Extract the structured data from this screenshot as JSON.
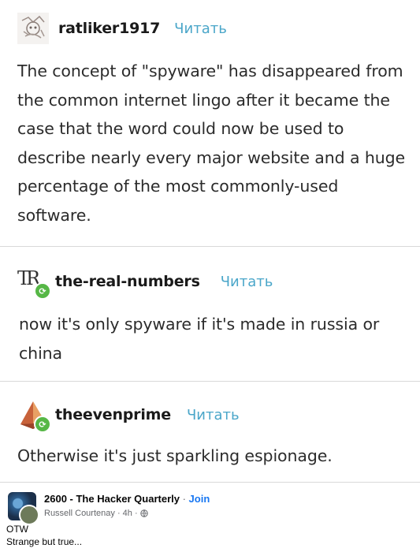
{
  "posts": [
    {
      "username": "ratliker1917",
      "follow_label": "Читать",
      "avatar_icon": "doodle-avatar-icon",
      "text": "The concept of \"spyware\" has disappeared from the common internet lingo after it became the case that the word could now be used to describe nearly every major website and a huge percentage of the most commonly-used software."
    },
    {
      "username": "the-real-numbers",
      "follow_label": "Читать",
      "avatar_icon": "tr-monogram-avatar-icon",
      "avatar_monogram": "TR",
      "text": "now it's only spyware if it's made in russia or china"
    },
    {
      "username": "theevenprime",
      "follow_label": "Читать",
      "avatar_icon": "tetrahedron-avatar-icon",
      "text": "Otherwise it's just sparkling espionage."
    }
  ],
  "facebook": {
    "group_name": "2600 - The Hacker Quarterly",
    "dot": " · ",
    "join_label": "Join",
    "author": "Russell Courtenay",
    "time": "4h",
    "privacy_icon": "globe-icon",
    "caption_line1": "OTW",
    "caption_line2": "Strange but true..."
  },
  "colors": {
    "follow": "#4aa6c9",
    "reblog_badge": "#56b746",
    "fb_join": "#1877f2"
  }
}
